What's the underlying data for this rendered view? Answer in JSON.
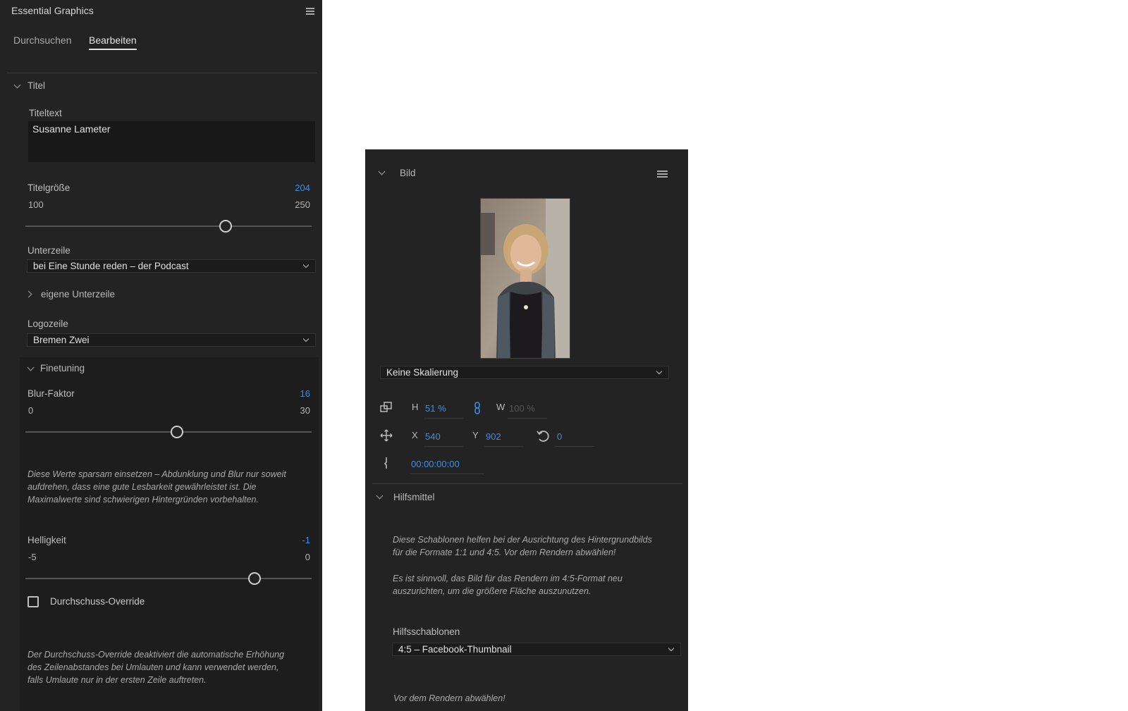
{
  "panel": {
    "title": "Essential Graphics",
    "tabs": [
      {
        "label": "Durchsuchen",
        "active": false
      },
      {
        "label": "Bearbeiten",
        "active": true
      }
    ]
  },
  "titel_section": {
    "header": "Titel",
    "titeltext_label": "Titeltext",
    "titeltext_value": "Susanne Lameter",
    "titelgroesse_label": "Titelgröße",
    "titelgroesse_value": "204",
    "titelgroesse_min": "100",
    "titelgroesse_max": "250",
    "titelgroesse_level": 0.7,
    "unterzeile_label": "Unterzeile",
    "unterzeile_value": "bei Eine Stunde reden – der Podcast",
    "eigene_unterzeile_label": "eigene Unterzeile",
    "logozeile_label": "Logozeile",
    "logozeile_value": "Bremen Zwei"
  },
  "finetuning": {
    "header": "Finetuning",
    "blur_label": "Blur-Faktor",
    "blur_value": "16",
    "blur_min": "0",
    "blur_max": "30",
    "blur_level": 0.53,
    "note1_line1": "Diese Werte sparsam einsetzen – Abdunklung und Blur nur soweit",
    "note1_line2": "aufdrehen, dass eine gute Lesbarkeit gewährleistet ist. Die",
    "note1_line3": "Maximalwerte sind schwierigen Hintergründen vorbehalten.",
    "helligkeit_label": "Helligkeit",
    "helligkeit_value": "-1",
    "helligkeit_min": "-5",
    "helligkeit_max": "0",
    "helligkeit_level": 0.8,
    "checkbox_label": "Durchschuss-Override",
    "checkbox_checked": false,
    "note2_line1": "Der Durchschuss-Override deaktiviert die automatische Erhöhung",
    "note2_line2": "des Zeilenabstandes bei Umlauten und kann verwendet werden,",
    "note2_line3": "falls Umlaute nur in der ersten Zeile auftreten."
  },
  "bild_panel": {
    "header": "Bild",
    "scaling_value": "Keine Skalierung",
    "h_label": "H",
    "h_value": "51 %",
    "w_label": "W",
    "w_value": "100 %",
    "x_label": "X",
    "x_value": "540",
    "y_label": "Y",
    "y_value": "902",
    "rotation_value": "0",
    "timecode": "00:00:00:00",
    "hilfsmittel_header": "Hilfsmittel",
    "hint1_line1": "Diese Schablonen helfen bei der Ausrichtung des Hintergrundbilds",
    "hint1_line2": "für die Formate 1:1 und 4:5. Vor dem Rendern abwählen!",
    "hint2_line1": "Es ist sinnvoll, das Bild für das Rendern im 4:5-Format neu",
    "hint2_line2": "auszurichten, um die größere Fläche auszunutzen.",
    "hilfsschablonen_label": "Hilfsschablonen",
    "hilfsschablonen_value": "4:5 – Facebook-Thumbnail",
    "footer_note": "Vor dem Rendern abwählen!"
  },
  "colors": {
    "panel_bg": "#232323",
    "accent_blue": "#3e8ee0"
  }
}
